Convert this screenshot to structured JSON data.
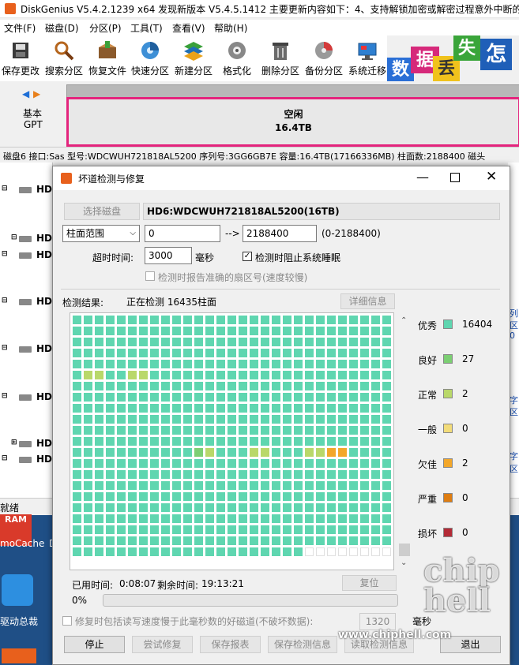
{
  "app": {
    "title": "DiskGenius V5.4.2.1239 x64    发现新版本 V5.4.5.1412    主要更新内容如下：4、支持解锁加密或解密过程意外中断的",
    "menu": [
      "文件(F)",
      "磁盘(D)",
      "分区(P)",
      "工具(T)",
      "查看(V)",
      "帮助(H)"
    ],
    "toolbar": [
      {
        "label": "保存更改",
        "icon": "save-icon"
      },
      {
        "label": "搜索分区",
        "icon": "magnifier-icon"
      },
      {
        "label": "恢复文件",
        "icon": "restore-box-icon"
      },
      {
        "label": "快速分区",
        "icon": "quick-partition-icon"
      },
      {
        "label": "新建分区",
        "icon": "new-partition-icon"
      },
      {
        "label": "格式化",
        "icon": "format-icon"
      },
      {
        "label": "删除分区",
        "icon": "trash-icon"
      },
      {
        "label": "备份分区",
        "icon": "backup-icon"
      },
      {
        "label": "系统迁移",
        "icon": "system-migrate-icon"
      }
    ],
    "banner": [
      "数",
      "据",
      "丢",
      "失",
      "怎"
    ],
    "disk_type": {
      "line1": "基本",
      "line2": "GPT"
    },
    "partition": {
      "name": "空闲",
      "size": "16.4TB"
    },
    "disk_info": "磁盘6 接口:Sas  型号:WDCWUH721818AL5200  序列号:3GG6GB7E  容量:16.4TB(17166336MB)  柱面数:2188400  磁头",
    "tree_nodes": [
      "HD",
      "HD",
      "HD",
      "HD",
      "HD",
      "HD",
      "HD",
      "HD"
    ],
    "status": "就绪",
    "right_fragments": [
      "列",
      "区",
      "0",
      "字",
      "区",
      "字",
      "区"
    ]
  },
  "desktop": {
    "icons": [
      {
        "label": "RAM"
      },
      {
        "label": "moCache"
      },
      {
        "label": "D"
      },
      {
        "label": "驱动总裁"
      }
    ],
    "watermark": "www.chiphell.com"
  },
  "dialog": {
    "title": "坏道检测与修复",
    "select_disk_btn": "选择磁盘",
    "disk_name": "HD6:WDCWUH721818AL5200(16TB)",
    "range_type": "柱面范围",
    "range_start": "0",
    "range_sep": "-->",
    "range_end": "2188400",
    "range_hint": "(0-2188400)",
    "timeout_label": "超时时间:",
    "timeout_value": "3000",
    "timeout_unit": "毫秒",
    "prevent_sleep_label": "检测时阻止系统睡眠",
    "prevent_sleep_checked": true,
    "accurate_sector_label": "检测时报告准确的扇区号(速度较慢)",
    "accurate_sector_checked": false,
    "result_label": "检测结果:",
    "result_status": "正在检测 16435柱面",
    "detail_btn": "详细信息",
    "legend": [
      {
        "label": "优秀",
        "count": "16404",
        "color": "#5fd6b0"
      },
      {
        "label": "良好",
        "count": "27",
        "color": "#7ccf73"
      },
      {
        "label": "正常",
        "count": "2",
        "color": "#b9d86a"
      },
      {
        "label": "一般",
        "count": "0",
        "color": "#f2dc7a"
      },
      {
        "label": "欠佳",
        "count": "2",
        "color": "#f3a72a"
      },
      {
        "label": "严重",
        "count": "0",
        "color": "#de7d12"
      },
      {
        "label": "损坏",
        "count": "0",
        "color": "#b32a36"
      }
    ],
    "elapsed_label": "已用时间:",
    "elapsed": "0:08:07",
    "remaining_label": "剩余时间:",
    "remaining": "19:13:21",
    "reset_btn": "复位",
    "progress_text": "0%",
    "progress_fraction": 0.0,
    "repair_slow_label": "修复时包括读写速度慢于此毫秒数的好磁道(不破坏数据):",
    "repair_slow_value": "1320",
    "repair_slow_unit": "毫秒",
    "buttons": [
      "停止",
      "尝试修复",
      "保存报表",
      "保存检测信息",
      "读取检测信息",
      "退出"
    ]
  }
}
